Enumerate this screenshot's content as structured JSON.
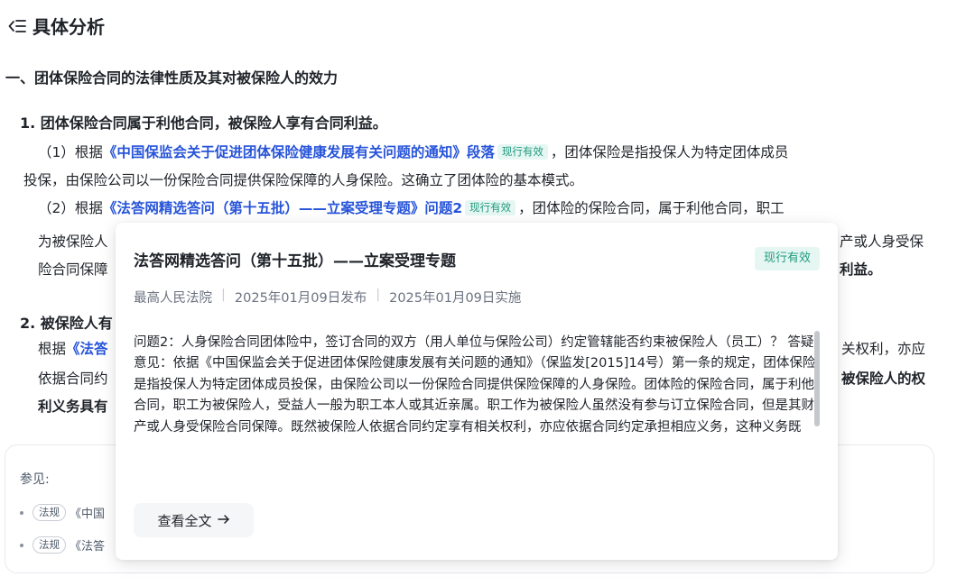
{
  "header": {
    "icon": "collapse-list-icon",
    "title": "具体分析"
  },
  "section1": {
    "heading": "一、团体保险合同的法律性质及其对被保险人的效力",
    "item1": {
      "heading": "1. 团体保险合同属于利他合同，被保险人享有合同利益。",
      "p1_prefix": "（1）根据",
      "p1_link": "《中国保监会关于促进团体保险健康发展有关问题的通知》段落",
      "p1_badge": "现行有效",
      "p1_text_a": "，团体保险是指投保人为特定团体成员",
      "p1_text_b": "投保，由保险公司以一份保险合同提供保险保障的人身保险。这确立了团体险的基本模式。",
      "p2_prefix": "（2）根据",
      "p2_link": "《法答网精选答问（第十五批）——立案受理专题》问题2",
      "p2_badge": "现行有效",
      "p2_text_a": "，团体险的保险合同，属于利他合同，职工",
      "p2_text_b_left": "为被保险人",
      "p2_text_b_right": "产或人身受保",
      "p2_text_c_left": "险合同保障",
      "p2_text_c_right": "利益。"
    },
    "item2": {
      "heading_visible": "2. 被保险人有",
      "line1_prefix": "根据",
      "line1_link_visible": "《法答",
      "line1_right": "关权利，亦应",
      "line2_left": "依据合同约",
      "line2_right": "被保险人的权",
      "line3_left": "利义务具有"
    }
  },
  "refs": {
    "title": "参见:",
    "items": [
      {
        "tag": "法规",
        "text": "《中国"
      },
      {
        "tag": "法规",
        "text": "《法答"
      }
    ]
  },
  "popup": {
    "title": "法答网精选答问（第十五批）——立案受理专题",
    "status": "现行有效",
    "issuer": "最高人民法院",
    "published": "2025年01月09日发布",
    "effective": "2025年01月09日实施",
    "separator": "|",
    "body": "问题2：人身保险合同团体险中，签订合同的双方（用人单位与保险公司）约定管辖能否约束被保险人（员工）？ 答疑意见：依据《中国保监会关于促进团体保险健康发展有关问题的通知》（保监发[2015]14号）第一条的规定，团体保险是指投保人为特定团体成员投保，由保险公司以一份保险合同提供保险保障的人身保险。团体险的保险合同，属于利他合同，职工为被保险人，受益人一般为职工本人或其近亲属。职工作为被保险人虽然没有参与订立保险合同，但是其财产或人身受保险合同保障。既然被保险人依据合同约定享有相关权利，亦应依据合同约定承担相应义务，这种义务既",
    "view_full": "查看全文",
    "view_full_icon": "arrow-right-icon"
  }
}
